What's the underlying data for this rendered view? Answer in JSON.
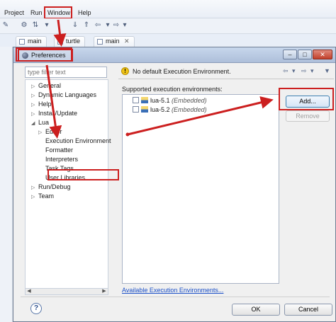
{
  "menubar": {
    "items": [
      "Project",
      "Run",
      "Window",
      "Help"
    ]
  },
  "editor_tabs": [
    {
      "label": "main"
    },
    {
      "label": "turtle"
    },
    {
      "label": "main",
      "close": "✕"
    }
  ],
  "dialog": {
    "title": "Preferences",
    "window_buttons": [
      "–",
      "□",
      "✕"
    ],
    "filter_placeholder": "type filter text",
    "tree": [
      {
        "label": "General",
        "expander": "▷"
      },
      {
        "label": "Dynamic Languages",
        "expander": "▷"
      },
      {
        "label": "Help",
        "expander": "▷"
      },
      {
        "label": "Install/Update",
        "expander": "▷"
      },
      {
        "label": "Lua",
        "expander": "◢"
      },
      {
        "label": "Editor",
        "expander": "▷"
      },
      {
        "label": "Execution Environment",
        "expander": "",
        "selected": true
      },
      {
        "label": "Formatter",
        "expander": ""
      },
      {
        "label": "Interpreters",
        "expander": ""
      },
      {
        "label": "Task Tags",
        "expander": ""
      },
      {
        "label": "User Libraries",
        "expander": ""
      },
      {
        "label": "Run/Debug",
        "expander": "▷"
      },
      {
        "label": "Team",
        "expander": "▷"
      }
    ],
    "message": "No default Execution Environment.",
    "supported_label": "Supported execution environments:",
    "environments": [
      {
        "name": "lua-5.1",
        "note": "(Embedded)",
        "checked": false
      },
      {
        "name": "lua-5.2",
        "note": "(Embedded)",
        "checked": false
      }
    ],
    "add_label": "Add...",
    "remove_label": "Remove",
    "link_label": "Available Execution Environments...",
    "ok_label": "OK",
    "cancel_label": "Cancel",
    "help_glyph": "?"
  },
  "colors": {
    "annotation_red": "#cc1f1f",
    "link_blue": "#1a4fc7",
    "titlebar": "#b9c9e2"
  }
}
